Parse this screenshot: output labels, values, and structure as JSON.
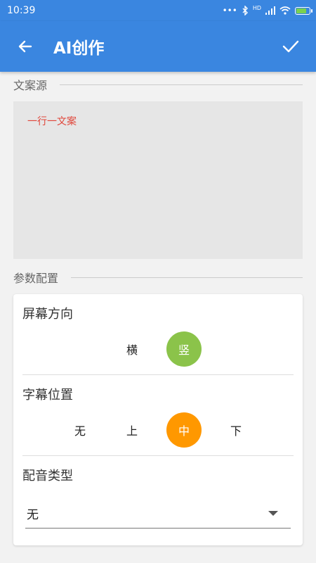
{
  "status_bar": {
    "time": "10:39",
    "signal_label": "HD",
    "icons": [
      "dots-icon",
      "bluetooth-icon",
      "signal-icon",
      "wifi-icon",
      "battery-charging-icon"
    ]
  },
  "app_bar": {
    "title": "AI创作",
    "back_icon": "arrow-left-icon",
    "confirm_icon": "check-icon",
    "color": "#3a86e0"
  },
  "source_section": {
    "header": "文案源",
    "text": "一行一文案",
    "text_color": "#e0463a"
  },
  "params_section": {
    "header": "参数配置",
    "screen_orientation": {
      "title": "屏幕方向",
      "options": [
        "横",
        "竖"
      ],
      "selected": "竖",
      "selected_color": "#8bc34a"
    },
    "subtitle_position": {
      "title": "字幕位置",
      "options": [
        "无",
        "上",
        "中",
        "下"
      ],
      "selected": "中",
      "selected_color": "#ff9800"
    },
    "voice_type": {
      "title": "配音类型",
      "value": "无"
    }
  }
}
